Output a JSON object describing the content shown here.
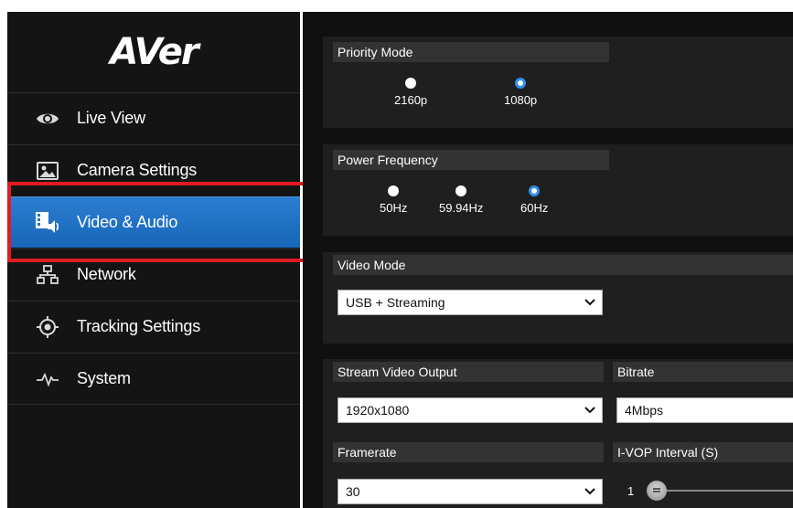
{
  "brand": {
    "logo_text": "AVer"
  },
  "sidebar": {
    "items": [
      {
        "label": "Live View",
        "icon": "eye-icon"
      },
      {
        "label": "Camera Settings",
        "icon": "image-icon"
      },
      {
        "label": "Video & Audio",
        "icon": "video-audio-icon",
        "active": true
      },
      {
        "label": "Network",
        "icon": "network-icon"
      },
      {
        "label": "Tracking Settings",
        "icon": "crosshair-icon"
      },
      {
        "label": "System",
        "icon": "pulse-icon"
      }
    ]
  },
  "priority_mode": {
    "title": "Priority Mode",
    "options": [
      "2160p",
      "1080p"
    ],
    "selected": "1080p"
  },
  "power_frequency": {
    "title": "Power Frequency",
    "options": [
      "50Hz",
      "59.94Hz",
      "60Hz"
    ],
    "selected": "60Hz"
  },
  "video_mode": {
    "title": "Video Mode",
    "value": "USB + Streaming"
  },
  "stream": {
    "output_title": "Stream Video Output",
    "output_value": "1920x1080",
    "bitrate_title": "Bitrate",
    "bitrate_value": "4Mbps",
    "framerate_title": "Framerate",
    "framerate_value": "30",
    "ivop_title": "I-VOP Interval (S)",
    "ivop_value": "1"
  },
  "colors": {
    "accent": "#1f72c4",
    "highlight": "#e11b22",
    "radio_selected": "#2f8ff0"
  }
}
